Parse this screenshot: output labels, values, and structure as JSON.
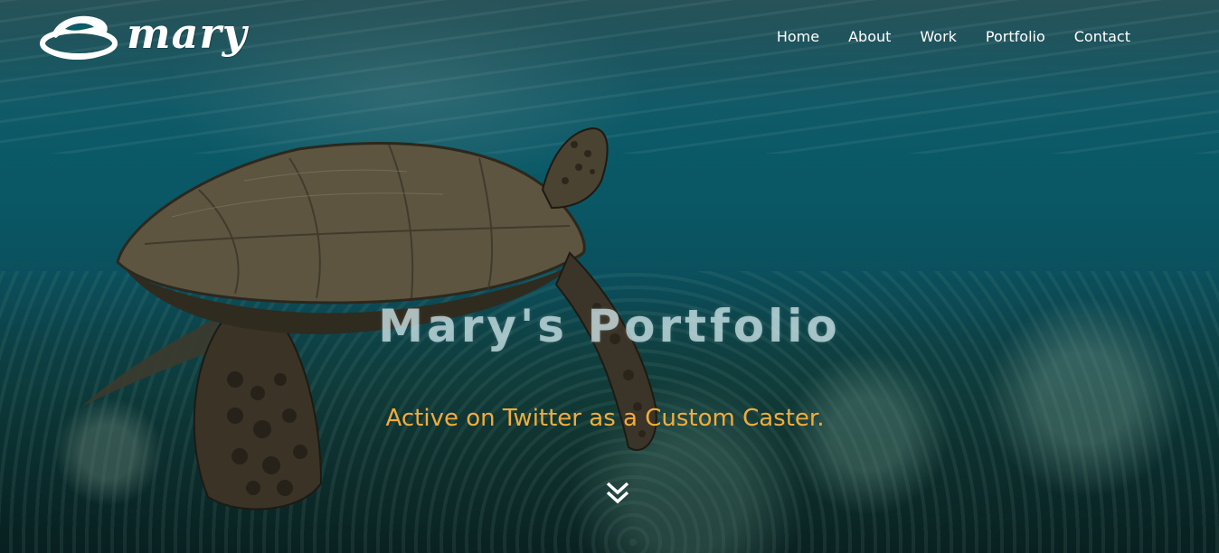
{
  "brand": {
    "logo_icon": "turtle-logo-icon",
    "name": "mary"
  },
  "nav": {
    "items": [
      {
        "label": "Home"
      },
      {
        "label": "About"
      },
      {
        "label": "Work"
      },
      {
        "label": "Portfolio"
      },
      {
        "label": "Contact"
      }
    ]
  },
  "hero": {
    "title": "Mary's Portfolio",
    "tagline": "Active on Twitter as a Custom Caster.",
    "scroll_icon": "double-chevron-down-icon",
    "background": "underwater-sea-turtle-photo"
  },
  "colors": {
    "accent": "#f1ac3c",
    "nav_text": "#ffffff",
    "water": "#0b5a68"
  }
}
